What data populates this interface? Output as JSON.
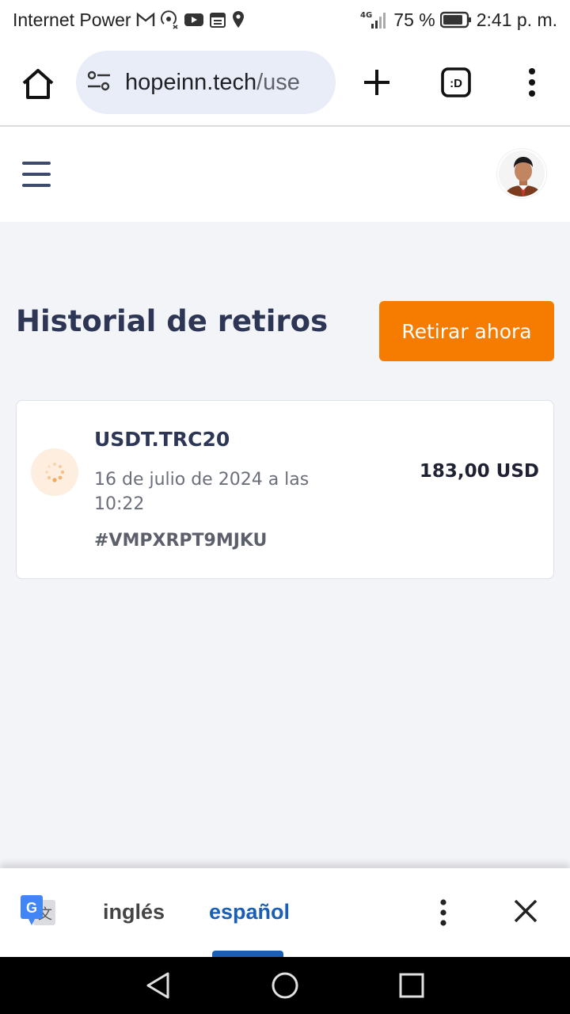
{
  "status_bar": {
    "carrier": "Internet Power",
    "network": "4G",
    "battery": "75 %",
    "time": "2:41 p. m."
  },
  "browser": {
    "url_domain": "hopeinn.tech",
    "url_path": "/use",
    "tabs_label": ":D"
  },
  "page": {
    "title": "Historial de retiros",
    "withdraw_button": "Retirar ahora"
  },
  "withdrawals": [
    {
      "coin": "USDT.TRC20",
      "date": "16 de julio de 2024 a las 10:22",
      "id": "#VMPXRPT9MJKU",
      "amount": "183,00 USD",
      "status": "pending"
    }
  ],
  "translate_bar": {
    "source_lang": "inglés",
    "target_lang": "español"
  },
  "colors": {
    "accent": "#f57c00",
    "title": "#2e3656",
    "page_bg": "#f3f4f8",
    "translate_active": "#1a5fb4"
  }
}
